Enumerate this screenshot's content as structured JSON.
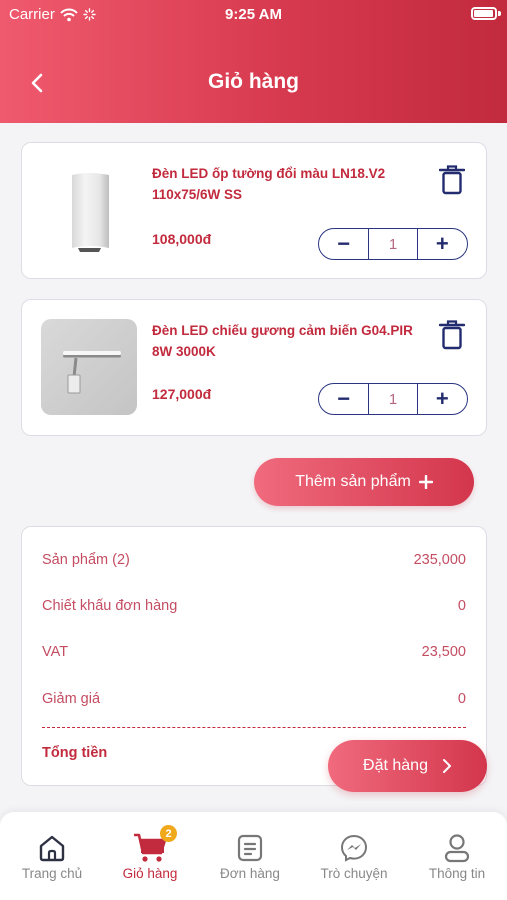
{
  "status_bar": {
    "carrier": "Carrier",
    "time": "9:25 AM"
  },
  "header": {
    "title": "Giỏ hàng",
    "back_icon": "chevron-left-icon"
  },
  "colors": {
    "primary": "#c22a3d",
    "primary_light": "#f05a6e",
    "navy": "#2b3580",
    "badge": "#f0a81c"
  },
  "cart": {
    "items": [
      {
        "name": "Đèn LED ốp tường đổi màu LN18.V2 110x75/6W SS",
        "price": "108,000đ",
        "quantity": "1"
      },
      {
        "name": "Đèn LED chiếu gương cảm biến G04.PIR 8W 3000K",
        "price": "127,000đ",
        "quantity": "1"
      }
    ],
    "add_product_label": "Thêm sản phẩm"
  },
  "summary": {
    "rows": [
      {
        "label": "Sản phẩm (2)",
        "value": "235,000"
      },
      {
        "label": "Chiết khấu đơn hàng",
        "value": "0"
      },
      {
        "label": "VAT",
        "value": "23,500"
      },
      {
        "label": "Giảm giá",
        "value": "0"
      }
    ],
    "total_label": "Tổng tiền",
    "order_button_label": "Đặt hàng"
  },
  "tabbar": {
    "items": [
      {
        "label": "Trang chủ",
        "icon": "home-icon"
      },
      {
        "label": "Giỏ hàng",
        "icon": "cart-icon",
        "badge": "2"
      },
      {
        "label": "Đơn hàng",
        "icon": "orders-icon"
      },
      {
        "label": "Trò chuyện",
        "icon": "messenger-icon"
      },
      {
        "label": "Thông tin",
        "icon": "user-icon"
      }
    ],
    "active_index": 1
  }
}
